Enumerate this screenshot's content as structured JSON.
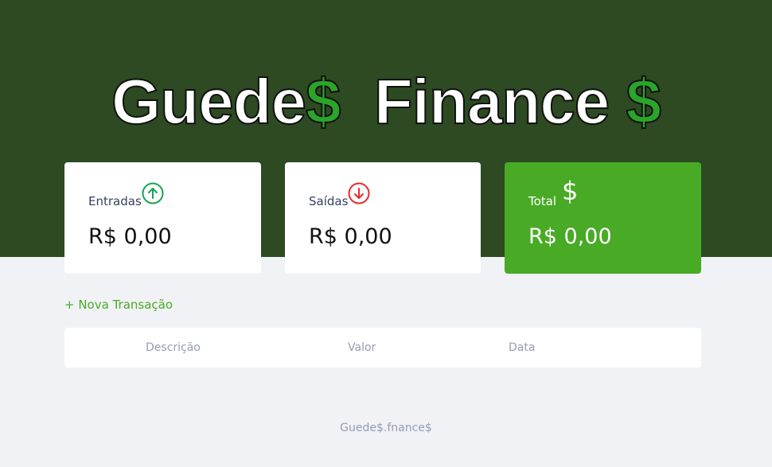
{
  "header": {
    "logo_word1": "Guede",
    "logo_dollar1": "$",
    "logo_word2": "Finance",
    "logo_dollar2": "$"
  },
  "cards": [
    {
      "label": "Entradas",
      "value": "R$ 0,00",
      "icon": "arrow-up-circle-icon"
    },
    {
      "label": "Saídas",
      "value": "R$ 0,00",
      "icon": "arrow-down-circle-icon"
    },
    {
      "label": "Total",
      "value": "R$ 0,00",
      "icon": "dollar-sign-icon",
      "icon_glyph": "$"
    }
  ],
  "new_transaction_label": "+ Nova Transação",
  "table": {
    "headers": [
      "Descrição",
      "Valor",
      "Data"
    ]
  },
  "footer": "Guede$.fnance$",
  "colors": {
    "header_bg": "#2d4a22",
    "accent_green": "#49aa26",
    "income_green": "#12a454",
    "expense_red": "#e92929"
  }
}
